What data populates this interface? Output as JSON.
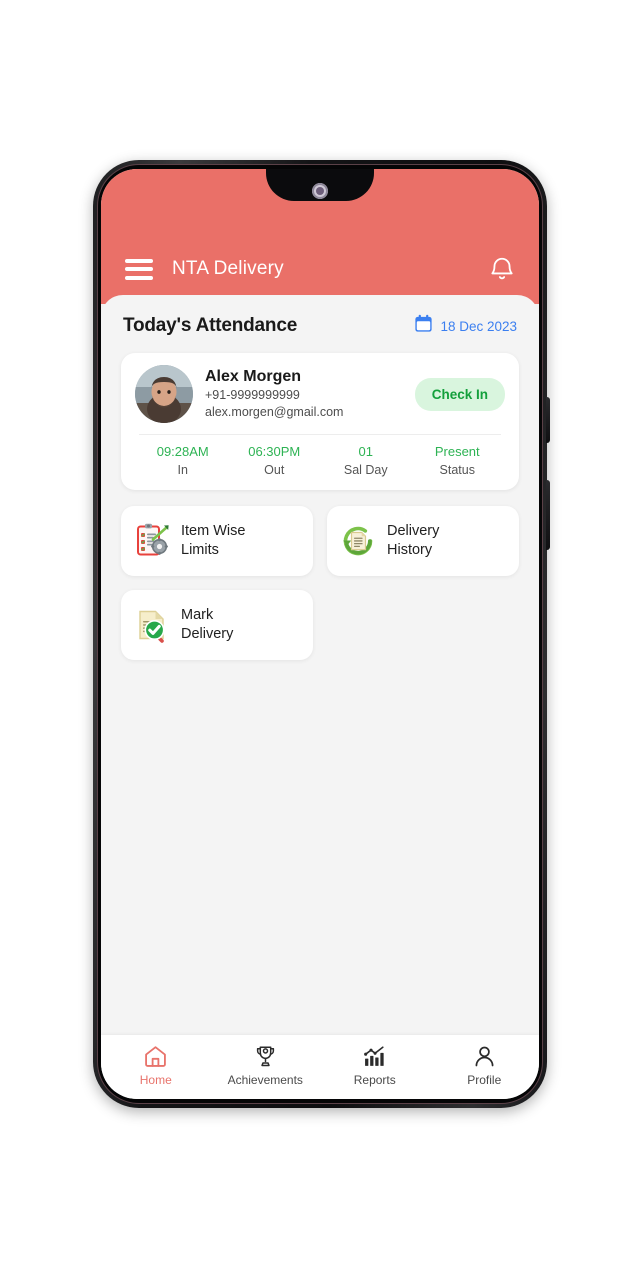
{
  "header": {
    "menu_icon": "hamburger-menu-icon",
    "title": "NTA Delivery",
    "notification_icon": "bell-icon",
    "background_color": "#ea7068"
  },
  "section": {
    "title": "Today's Attendance",
    "date_icon": "calendar-icon",
    "date": "18 Dec 2023",
    "date_color": "#3b7ff0"
  },
  "attendance_card": {
    "avatar": "user-avatar-photo",
    "name": "Alex Morgen",
    "phone": "+91-9999999999",
    "email": "alex.morgen@gmail.com",
    "check_in_label": "Check In",
    "check_in_bg": "#d9f5de",
    "check_in_color": "#14a03c",
    "stats": [
      {
        "value": "09:28AM",
        "label": "In"
      },
      {
        "value": "06:30PM",
        "label": "Out"
      },
      {
        "value": "01",
        "label": "Sal Day"
      },
      {
        "value": "Present",
        "label": "Status"
      }
    ],
    "stat_value_color": "#2eb354"
  },
  "tiles": [
    {
      "icon": "clipboard-gear-icon",
      "line1": "Item Wise",
      "line2": "Limits"
    },
    {
      "icon": "history-refresh-document-icon",
      "line1": "Delivery",
      "line2": "History"
    },
    {
      "icon": "document-check-magnifier-icon",
      "line1": "Mark",
      "line2": "Delivery"
    }
  ],
  "bottom_nav": {
    "active_color": "#e8736b",
    "items": [
      {
        "icon": "home-icon",
        "label": "Home",
        "active": true
      },
      {
        "icon": "trophy-icon",
        "label": "Achievements",
        "active": false
      },
      {
        "icon": "bar-chart-icon",
        "label": "Reports",
        "active": false
      },
      {
        "icon": "person-icon",
        "label": "Profile",
        "active": false
      }
    ]
  }
}
